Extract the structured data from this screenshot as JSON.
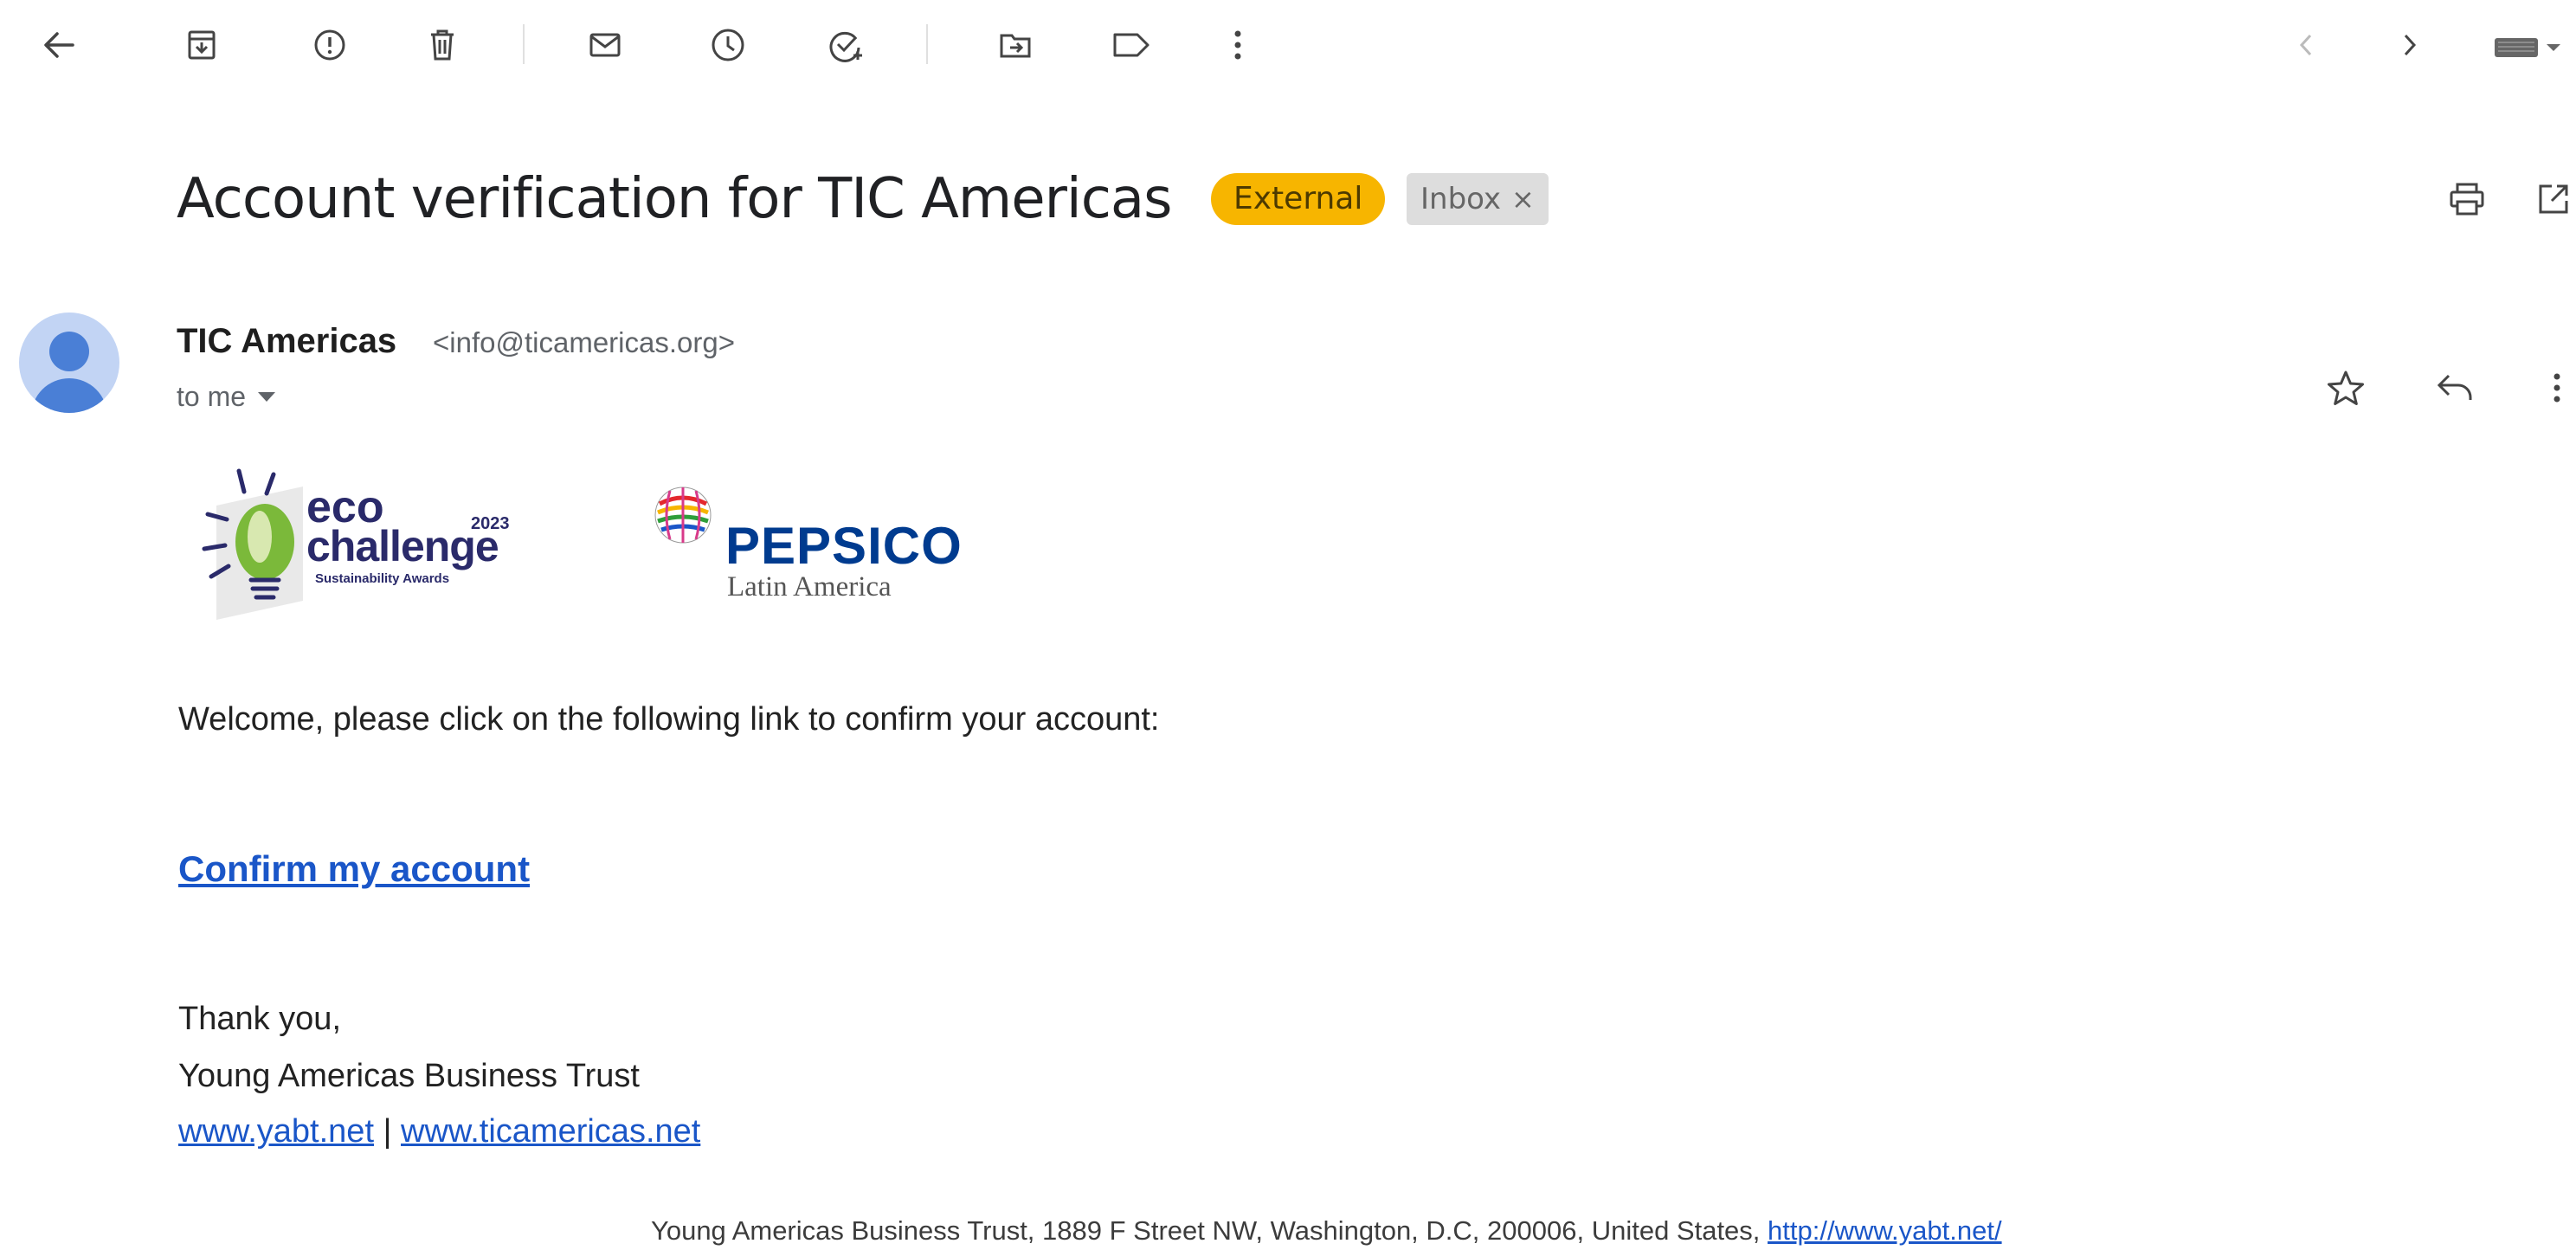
{
  "toolbar": {
    "icons": [
      "back-arrow-icon",
      "archive-icon",
      "report-spam-icon",
      "delete-icon",
      "mark-unread-icon",
      "snooze-icon",
      "add-task-icon",
      "move-to-icon",
      "label-icon",
      "more-vert-icon"
    ],
    "nav": [
      "prev-icon",
      "next-icon",
      "keyboard-icon"
    ]
  },
  "email": {
    "subject": "Account verification for TIC Americas",
    "labels": {
      "external": "External",
      "inbox": "Inbox",
      "inbox_remove": "×"
    },
    "sender_name": "TIC Americas",
    "sender_email": "<info@ticamericas.org>",
    "to": "to me"
  },
  "logos": {
    "eco": {
      "line1": "eco",
      "line2": "challenge",
      "year": "2023",
      "tagline": "Sustainability Awards"
    },
    "pepsico": {
      "name": "PEPSICO",
      "region": "Latin America"
    }
  },
  "body": {
    "welcome": "Welcome, please click on the following link to confirm your account:",
    "confirm_link": "Confirm my account",
    "thanks": "Thank you,",
    "org": "Young Americas Business Trust",
    "link1": "www.yabt.net",
    "divider": "|",
    "link2": "www.ticamericas.net"
  },
  "footer": {
    "address": "Young Americas Business Trust, 1889 F Street NW, Washington, D.C, 200006, United States,",
    "url": "http://www.yabt.net/"
  },
  "colors": {
    "external_chip": "#f7b500",
    "link": "#1a56c8",
    "pepsi_blue": "#003b8f",
    "eco_green": "#2e9e3a"
  }
}
